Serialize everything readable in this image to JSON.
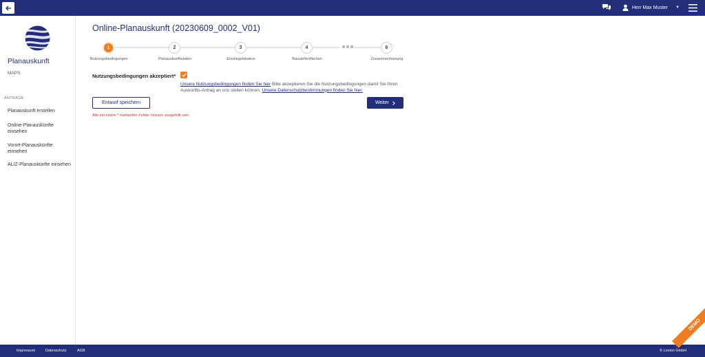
{
  "topbar": {
    "user_name": "Herr Max Muster"
  },
  "sidebar": {
    "app_title": "Planauskunft",
    "app_subtitle": "MAPS",
    "section_label": "ANTRAGE",
    "items": [
      {
        "label": "Planauskunft erstellen"
      },
      {
        "label": "Online-Planauskünfte einsehen"
      },
      {
        "label": "Vorort-Planauskünfte einsehen"
      },
      {
        "label": "ALIZ-Planauskünfte einsehen"
      }
    ]
  },
  "main": {
    "title": "Online-Planauskunft (20230609_0002_V01)",
    "steps": [
      {
        "number": "1",
        "label": "Nutzungsbedingungen",
        "active": true
      },
      {
        "number": "2",
        "label": "Planauskunftsdaten"
      },
      {
        "number": "3",
        "label": "Einstiegslokation"
      },
      {
        "number": "4",
        "label": "Baustellenflächen"
      },
      {
        "number": "6",
        "label": "Zusammenfassung"
      }
    ],
    "terms_label": "Nutzungsbedingungen akzeptiert*",
    "terms_checked": true,
    "terms_link": "Unsere Nutzungsbedingungen finden Sie hier",
    "terms_text": " Bitte akzeptieren Sie die Nutzungsbedingungen damit Sie Ihren Auskunfts-Antrag an uns stellen können. ",
    "privacy_link": "Unsere Datenschutzbestimmungen finden Sie hier.",
    "save_draft_label": "Entwurf speichern",
    "next_label": "Weiter",
    "required_note": "Alle mit einem * markierten Felder müssen ausgefüllt sein."
  },
  "footer": {
    "links": [
      "Impressum",
      "Datenschutz",
      "AGB"
    ],
    "copyright": "© Lovion GmbH"
  },
  "demo_label": "DEMO",
  "colors": {
    "primary": "#232e7a",
    "accent": "#ef7d22",
    "error": "#c0392b"
  }
}
